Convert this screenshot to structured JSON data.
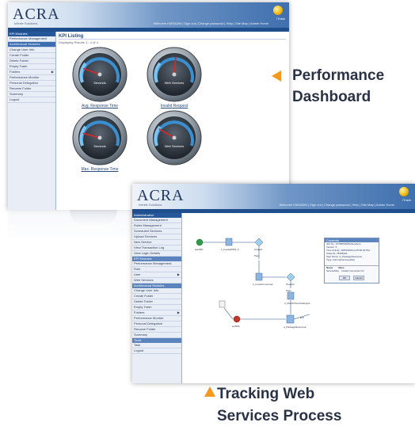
{
  "screen1": {
    "logo": "ACRA",
    "logo_tagline": "Infinite Solutions",
    "header_icon_label": "iTrack",
    "header_text": "Welcome KMSADM | Sign out | Change password | Help | Site Map | Admin Home",
    "sidebar": {
      "heading": "KPI Modules",
      "items": [
        {
          "label": "Performance Management",
          "selected": false,
          "arrow": false
        },
        {
          "label": "Architectural Modules",
          "selected": true,
          "arrow": false
        },
        {
          "label": "Change User Info",
          "selected": false,
          "arrow": false
        },
        {
          "label": "Create Folder",
          "selected": false,
          "arrow": false
        },
        {
          "label": "Delete Folder",
          "selected": false,
          "arrow": false
        },
        {
          "label": "Empty Trash",
          "selected": false,
          "arrow": false
        },
        {
          "label": "Folders",
          "selected": false,
          "arrow": true
        },
        {
          "label": "Performance Monitor",
          "selected": false,
          "arrow": false
        },
        {
          "label": "Personal Delegation",
          "selected": false,
          "arrow": false
        },
        {
          "label": "Rename Folder",
          "selected": false,
          "arrow": false
        },
        {
          "label": "Summary",
          "selected": false,
          "arrow": false
        },
        {
          "label": "Logout",
          "selected": false,
          "arrow": false
        }
      ]
    },
    "kpi_title": "KPI Listing",
    "kpi_subtitle": "Displaying Results 1 - 4 of 4",
    "gauges": [
      {
        "center_label": "Seconds",
        "link": "Avg. Response Time",
        "needle_deg": -70
      },
      {
        "center_label": "Web Services",
        "link": "Invalid Request",
        "needle_deg": 5
      },
      {
        "center_label": "Seconds",
        "link": "Max. Response Time",
        "needle_deg": -75
      },
      {
        "center_label": "Web Services",
        "link": "",
        "needle_deg": -60
      }
    ]
  },
  "screen2": {
    "logo": "ACRA",
    "logo_tagline": "Infinite Solutions",
    "header_icon_label": "iTrack",
    "header_text": "Welcome KMSADM | Sign out | Change password | Help | Site Map | Admin Home",
    "sidebar": {
      "heading": "Administration",
      "items": [
        {
          "label": "Document Management",
          "type": "item"
        },
        {
          "label": "Rules Management",
          "type": "item"
        },
        {
          "label": "Scheduled Services",
          "type": "item"
        },
        {
          "label": "Upload Services",
          "type": "item"
        },
        {
          "label": "New Service",
          "type": "item"
        },
        {
          "label": "View Transaction Log",
          "type": "item"
        },
        {
          "label": "View Login Details",
          "type": "item"
        },
        {
          "label": "KPI Modules",
          "type": "section"
        },
        {
          "label": "Performance Management",
          "type": "item"
        },
        {
          "label": "Role",
          "type": "item"
        },
        {
          "label": "User",
          "type": "item",
          "arrow": true
        },
        {
          "label": "Web Services",
          "type": "item"
        },
        {
          "label": "Architectural Modules",
          "type": "section"
        },
        {
          "label": "Change User Info",
          "type": "item"
        },
        {
          "label": "Create Folder",
          "type": "item"
        },
        {
          "label": "Delete Folder",
          "type": "item"
        },
        {
          "label": "Empty Trash",
          "type": "item"
        },
        {
          "label": "Folders",
          "type": "item",
          "arrow": true
        },
        {
          "label": "Performance Monitor",
          "type": "item"
        },
        {
          "label": "Personal Delegation",
          "type": "item"
        },
        {
          "label": "Rename Folder",
          "type": "item"
        },
        {
          "label": "Summary",
          "type": "item"
        },
        {
          "label": "Tools",
          "type": "section"
        },
        {
          "label": "Task",
          "type": "item"
        },
        {
          "label": "Logout",
          "type": "item"
        }
      ]
    },
    "flow_nodes": {
      "start": "startMS",
      "n1": "1_InvokeDWS_0",
      "check1": "Output1",
      "pass1": "Pass",
      "n2": "2_InvokeConsumer",
      "check2": "Output2",
      "pass2": "Pass",
      "n3": "3_MonitorServiceEngine",
      "n4": "4_PackageResponse",
      "end": "endMS",
      "exit": "Exit"
    },
    "properties": {
      "heading": "Contents",
      "rows": [
        "Job No.: 16785PMWSClientAuto",
        "Version: 5",
        "Time Activity: 18/09/2009 at 05:56:30 PM",
        "Class ID: 78405026",
        "Step Name: 4_PackageResponse",
        "Type: Informational (public)"
      ],
      "table_headers": [
        "Name",
        "Value"
      ],
      "table_row": [
        "ServiceMsg",
        "Invalid Connection ID"
      ],
      "buttons": [
        "OK",
        "Cancel"
      ]
    }
  },
  "callouts": {
    "performance_line1": "Performance",
    "performance_line2": "Dashboard",
    "tracking_line1": "Tracking Web",
    "tracking_line2": "Services Process"
  },
  "colors": {
    "accent_arrow": "#f39a1e",
    "callout_text": "#2a3246",
    "nav_blue": "#1f4e8c",
    "sidebar_bg": "#e9eef6",
    "gauge_arc": "#3a8fd0",
    "needle": "#d8252a"
  },
  "icons": [
    "triangle-left-icon",
    "triangle-up-icon",
    "itrack-logo-icon",
    "speedometer-gauge",
    "workflow-node-icon"
  ]
}
